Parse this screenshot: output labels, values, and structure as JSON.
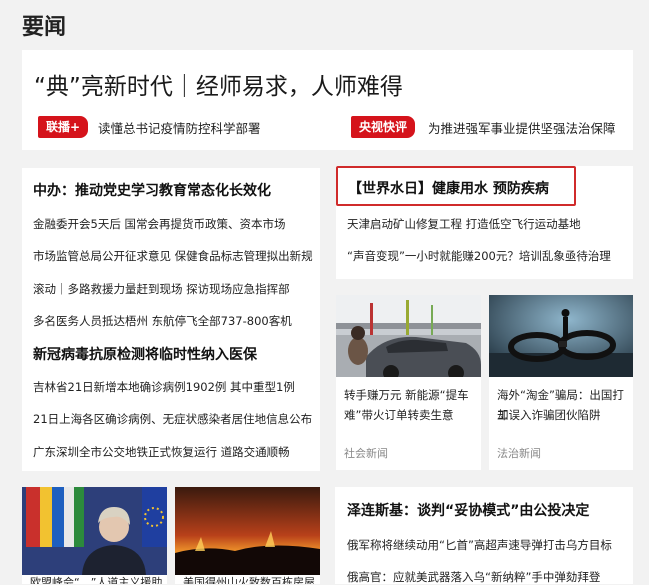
{
  "section": {
    "title": "要闻"
  },
  "hero": {
    "headline": "“典”亮新时代｜经师易求，人师难得",
    "badges": [
      {
        "label": "联播+",
        "link": "读懂总书记疫情防控科学部署"
      },
      {
        "label": "央视快评",
        "link": "为推进强军事业提供坚强法治保障"
      }
    ]
  },
  "left_column": {
    "heading1": "中办：推动党史学习教育常态化长效化",
    "lines1": [
      "金融委开会5天后 国常会再提货币政策、资本市场",
      "市场监管总局公开征求意见 保健食品标志管理拟出新规",
      "滚动｜多路救援力量赶到现场 探访现场应急指挥部",
      "多名医务人员抵达梧州 东航停飞全部737-800客机"
    ],
    "heading2": "新冠病毒抗原检测将临时性纳入医保",
    "lines2": [
      "吉林省21日新增本地确诊病例1902例 其中重型1例",
      "21日上海各区确诊病例、无症状感染者居住地信息公布",
      "广东深圳全市公交地铁正式恢复运行 道路交通顺畅"
    ]
  },
  "water_card": {
    "title": "【世界水日】健康用水 预防疾病",
    "lines": [
      "天津启动矿山修复工程 打造低空飞行运动基地",
      "“声音变现”一小时就能赚200元？培训乱象亟待治理"
    ]
  },
  "image_cards": [
    {
      "caption_line1": "转手赚万元 新能源“提车",
      "caption_line2": "难”带火订单转卖生意",
      "source": "社会新闻"
    },
    {
      "caption_line1": "海外“淘金”骗局：出国打工",
      "caption_line2": "却误入诈骗团伙陷阱",
      "source": "法治新闻"
    }
  ],
  "bottom_right": {
    "heading": "泽连斯基：谈判“妥协模式”由公投决定",
    "lines": [
      "俄军称将继续动用“匕首”高超声速导弹打击乌方目标",
      "俄高官：应就美武器落入乌“新纳粹”手中弹劾拜登"
    ]
  },
  "bottom_left_partial": {
    "caption_a": "欧盟峰会“…”人道主义援助",
    "caption_b": "美国得州山火致数百栋房屋"
  },
  "colors": {
    "accent_red": "#d5131b",
    "highlight_border": "#d02b2b",
    "source_gray": "#888888"
  }
}
